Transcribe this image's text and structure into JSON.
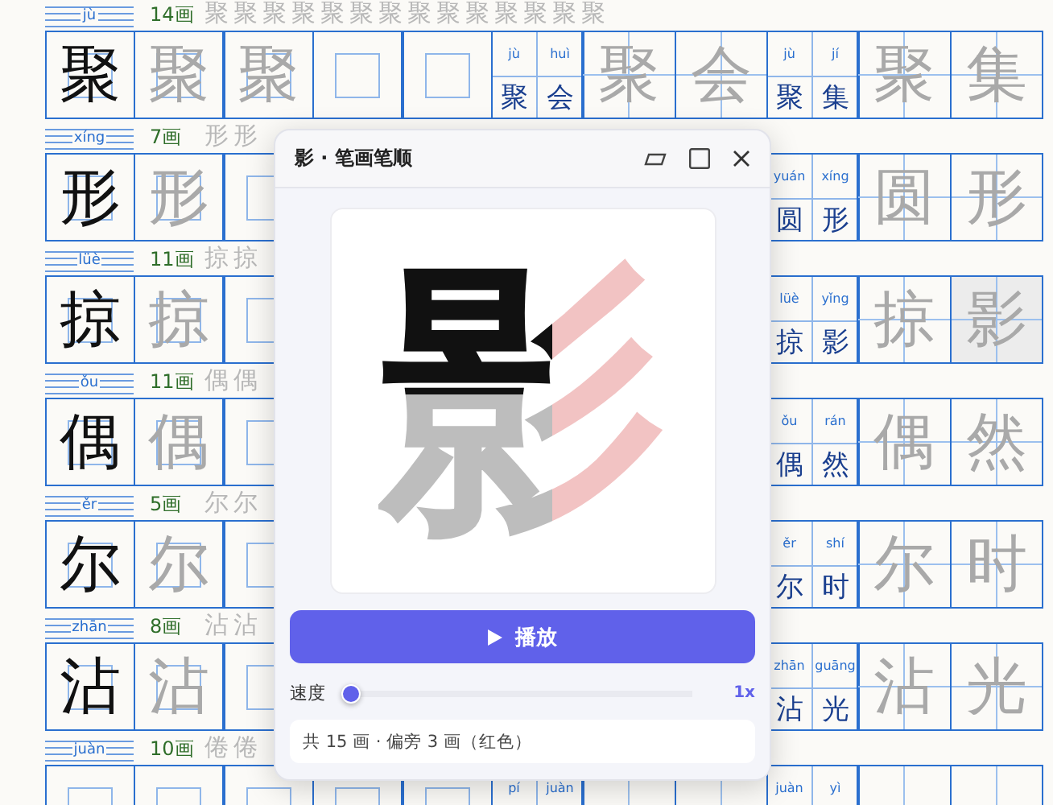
{
  "rows": [
    {
      "pinyin": "jù",
      "strokes": "14画",
      "stroke_order": [
        "聚",
        "聚",
        "聚",
        "聚",
        "聚",
        "聚",
        "聚",
        "聚",
        "聚",
        "聚",
        "聚",
        "聚",
        "聚",
        "聚"
      ],
      "char": "聚",
      "traces": [
        "聚",
        "聚"
      ],
      "word_1": {
        "syllables": [
          {
            "pinyin": "jù",
            "char": "聚"
          },
          {
            "pinyin": "huì",
            "char": "会"
          }
        ],
        "traces": [
          {
            "char": "聚",
            "highlighted": false
          },
          {
            "char": "会",
            "highlighted": false
          }
        ]
      },
      "word_2": {
        "syllables": [
          {
            "pinyin": "jù",
            "char": "聚"
          },
          {
            "pinyin": "jí",
            "char": "集"
          }
        ],
        "traces": [
          {
            "char": "聚",
            "highlighted": false
          },
          {
            "char": "集",
            "highlighted": false
          }
        ]
      }
    },
    {
      "pinyin": "xíng",
      "strokes": "7画",
      "stroke_order": [
        "形",
        "形"
      ],
      "char": "形",
      "traces": [
        "形"
      ],
      "word_2": {
        "syllables": [
          {
            "pinyin": "yuán",
            "char": "圆"
          },
          {
            "pinyin": "xíng",
            "char": "形"
          }
        ],
        "traces": [
          {
            "char": "圆",
            "highlighted": false
          },
          {
            "char": "形",
            "highlighted": false
          }
        ]
      }
    },
    {
      "pinyin": "lüè",
      "strokes": "11画",
      "stroke_order": [
        "掠",
        "掠"
      ],
      "char": "掠",
      "traces": [
        "掠"
      ],
      "word_2": {
        "syllables": [
          {
            "pinyin": "lüè",
            "char": "掠"
          },
          {
            "pinyin": "yǐng",
            "char": "影"
          }
        ],
        "traces": [
          {
            "char": "掠",
            "highlighted": false
          },
          {
            "char": "影",
            "highlighted": true
          }
        ]
      }
    },
    {
      "pinyin": "ǒu",
      "strokes": "11画",
      "stroke_order": [
        "偶",
        "偶"
      ],
      "char": "偶",
      "traces": [
        "偶"
      ],
      "word_2": {
        "syllables": [
          {
            "pinyin": "ǒu",
            "char": "偶"
          },
          {
            "pinyin": "rán",
            "char": "然"
          }
        ],
        "traces": [
          {
            "char": "偶",
            "highlighted": false
          },
          {
            "char": "然",
            "highlighted": false
          }
        ]
      }
    },
    {
      "pinyin": "ěr",
      "strokes": "5画",
      "stroke_order": [
        "尔",
        "尔"
      ],
      "char": "尔",
      "traces": [
        "尔"
      ],
      "word_2": {
        "syllables": [
          {
            "pinyin": "ěr",
            "char": "尔"
          },
          {
            "pinyin": "shí",
            "char": "时"
          }
        ],
        "traces": [
          {
            "char": "尔",
            "highlighted": false
          },
          {
            "char": "时",
            "highlighted": false
          }
        ]
      }
    },
    {
      "pinyin": "zhān",
      "strokes": "8画",
      "stroke_order": [
        "沾",
        "沾"
      ],
      "char": "沾",
      "traces": [
        "沾"
      ],
      "word_2": {
        "syllables": [
          {
            "pinyin": "zhān",
            "char": "沾"
          },
          {
            "pinyin": "guāng",
            "char": "光"
          }
        ],
        "traces": [
          {
            "char": "沾",
            "highlighted": false
          },
          {
            "char": "光",
            "highlighted": false
          }
        ]
      }
    },
    {
      "pinyin": "juàn",
      "strokes": "10画",
      "stroke_order": [
        "倦",
        "倦"
      ],
      "word_1": {
        "syllables": [
          {
            "pinyin": "pí"
          },
          {
            "pinyin": "juàn"
          }
        ]
      },
      "word_2": {
        "syllables": [
          {
            "pinyin": "juàn"
          },
          {
            "pinyin": "yì"
          }
        ]
      }
    }
  ],
  "dialog": {
    "title": "影 · 笔画笔顺",
    "character": "影",
    "play_button": "播放",
    "speed": {
      "label": "速度",
      "level": 0,
      "reading": "1x"
    },
    "info": "共 15 画 · 偏旁 3 画（红色）"
  }
}
